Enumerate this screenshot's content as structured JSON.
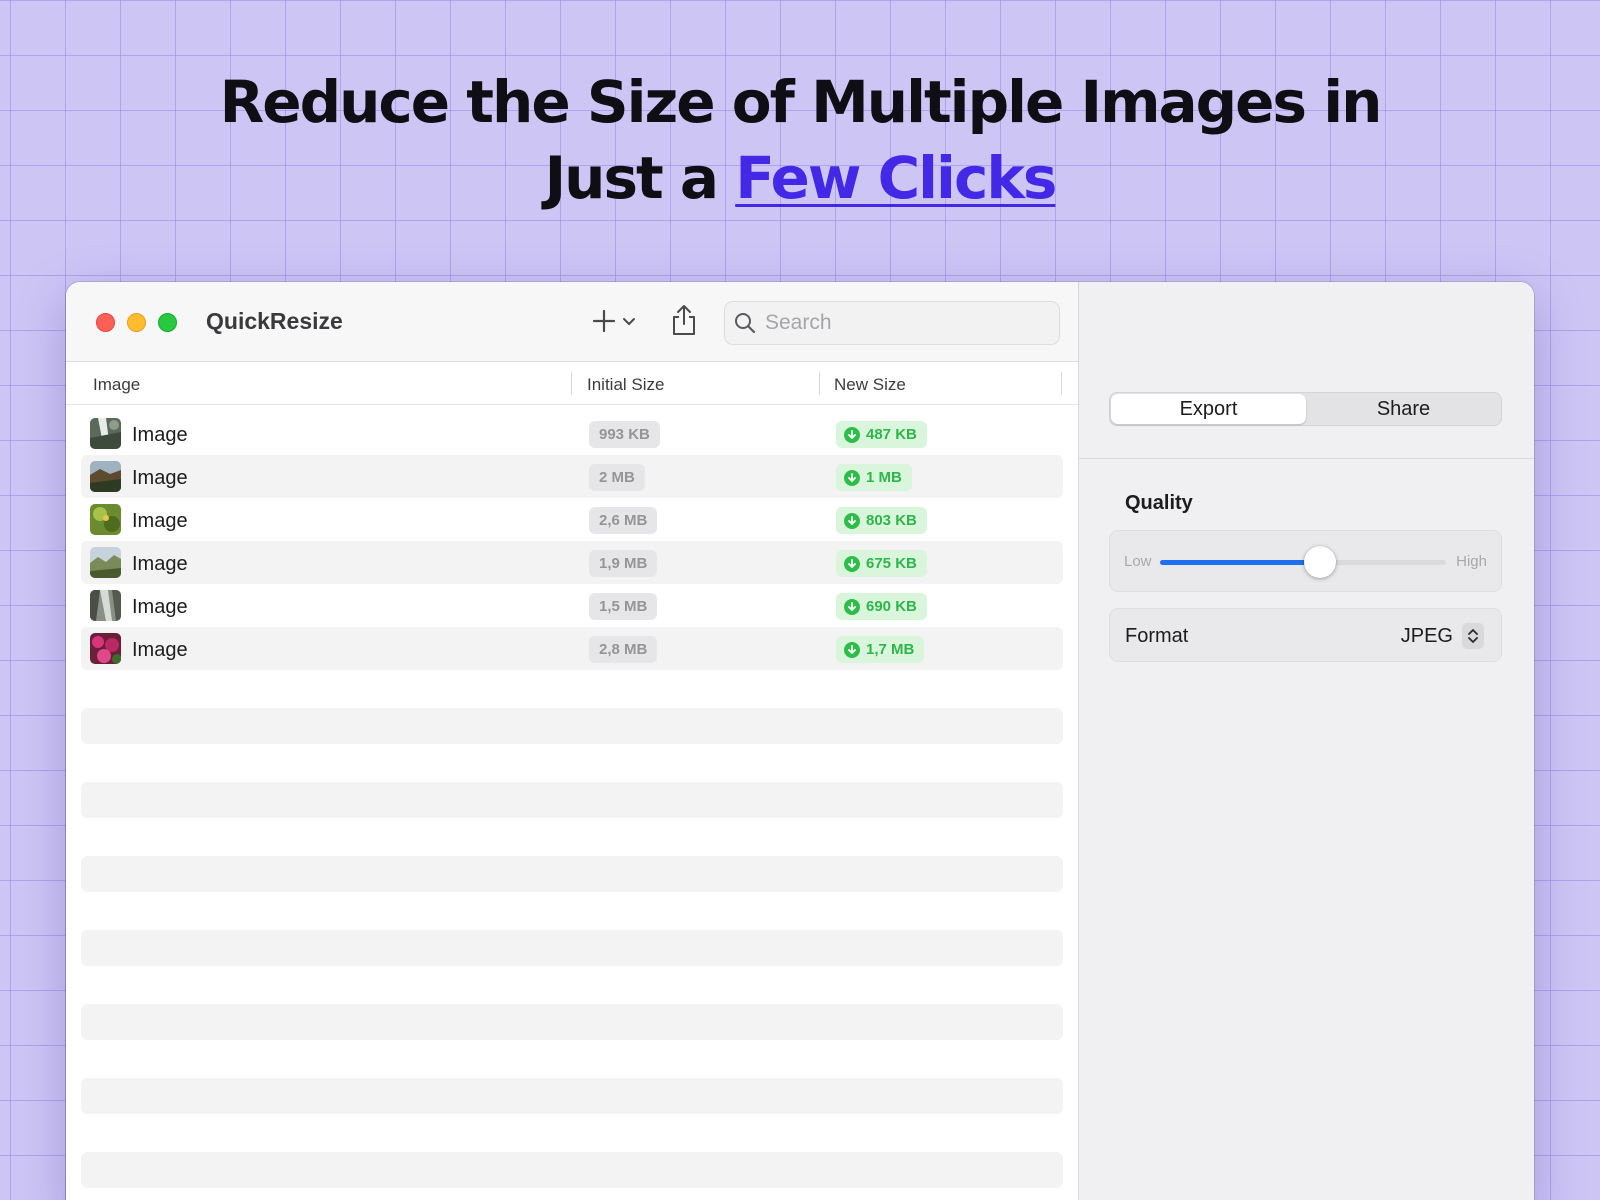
{
  "headline": {
    "line1": "Reduce the Size of Multiple Images in",
    "line2_prefix": "Just a ",
    "line2_accent": "Few Clicks"
  },
  "window": {
    "title": "QuickResize",
    "search_placeholder": "Search"
  },
  "table": {
    "columns": [
      "Image",
      "Initial Size",
      "New Size"
    ],
    "rows": [
      {
        "name": "Image",
        "initial": "993 KB",
        "new": "487 KB"
      },
      {
        "name": "Image",
        "initial": "2 MB",
        "new": "1 MB"
      },
      {
        "name": "Image",
        "initial": "2,6 MB",
        "new": "803 KB"
      },
      {
        "name": "Image",
        "initial": "1,9 MB",
        "new": "675 KB"
      },
      {
        "name": "Image",
        "initial": "1,5 MB",
        "new": "690 KB"
      },
      {
        "name": "Image",
        "initial": "2,8 MB",
        "new": "1,7 MB"
      }
    ]
  },
  "sidebar": {
    "tabs": [
      "Export",
      "Share"
    ],
    "active_tab": "Export",
    "quality": {
      "label": "Quality",
      "low": "Low",
      "high": "High",
      "value": 0.56
    },
    "format": {
      "label": "Format",
      "value": "JPEG"
    }
  },
  "colors": {
    "accent": "#4328e6",
    "slider": "#1f6ff0",
    "saved_green": "#2fb64a"
  }
}
